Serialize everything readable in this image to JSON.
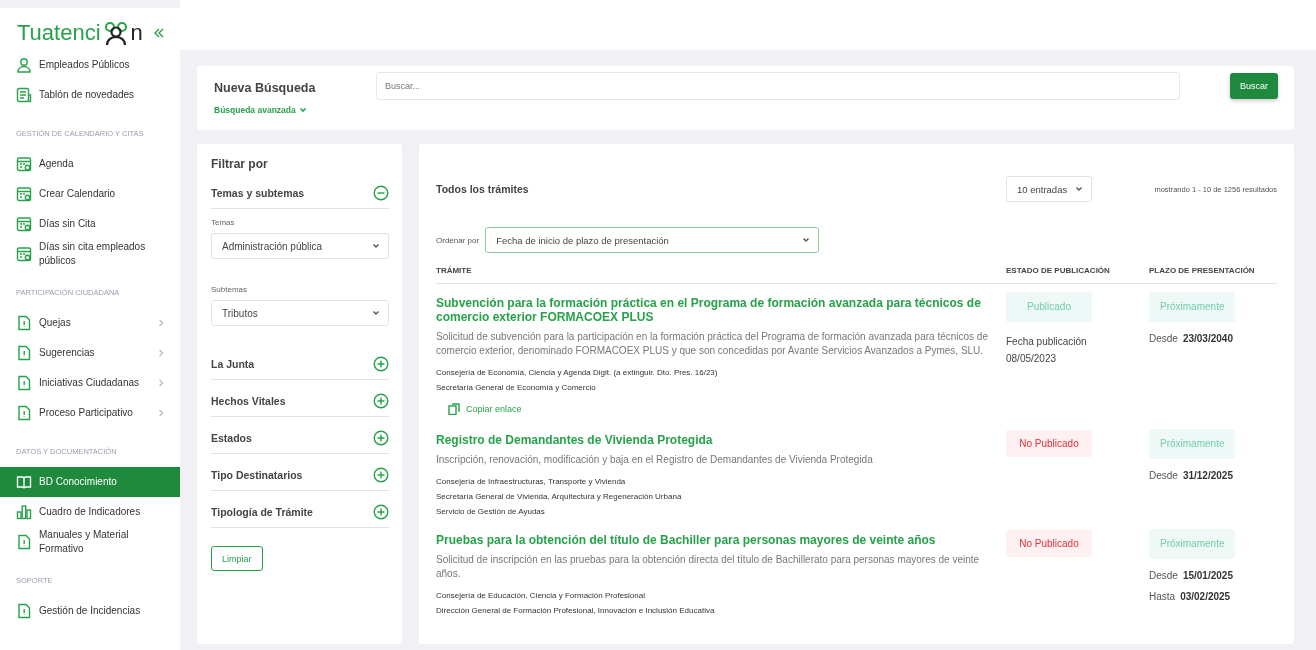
{
  "logo": {
    "text_start": "Tuatenci",
    "text_end": "n"
  },
  "sidebar": {
    "items": [
      {
        "kind": "item",
        "label": "Empleados Públicos",
        "selected": false,
        "has_submenu": false
      },
      {
        "kind": "item",
        "label": "Tablón de novedades",
        "selected": false,
        "has_submenu": false
      },
      {
        "kind": "header",
        "label": "GESTIÓN DE CALENDARIO Y CITAS"
      },
      {
        "kind": "item",
        "label": "Agenda",
        "selected": false,
        "has_submenu": false
      },
      {
        "kind": "item",
        "label": "Crear Calendario",
        "selected": false,
        "has_submenu": false
      },
      {
        "kind": "item",
        "label": "Días sin Cita",
        "selected": false,
        "has_submenu": false
      },
      {
        "kind": "item",
        "label": "Días sin cita empleados públicos",
        "selected": false,
        "has_submenu": false
      },
      {
        "kind": "header",
        "label": "PARTICIPACIÓN CIUDADANA"
      },
      {
        "kind": "item",
        "label": "Quejas",
        "selected": false,
        "has_submenu": true
      },
      {
        "kind": "item",
        "label": "Sugerencias",
        "selected": false,
        "has_submenu": true
      },
      {
        "kind": "item",
        "label": "Iniciativas Ciudadanas",
        "selected": false,
        "has_submenu": true
      },
      {
        "kind": "item",
        "label": "Proceso Participativo",
        "selected": false,
        "has_submenu": true
      },
      {
        "kind": "header",
        "label": "DATOS Y DOCUMENTACIÓN"
      },
      {
        "kind": "item",
        "label": "BD Conocimiento",
        "selected": true,
        "has_submenu": false
      },
      {
        "kind": "item",
        "label": "Cuadro de Indicadores",
        "selected": false,
        "has_submenu": false
      },
      {
        "kind": "item",
        "label": "Manuales y Material Formativo",
        "selected": false,
        "has_submenu": false
      },
      {
        "kind": "header",
        "label": "SOPORTE"
      },
      {
        "kind": "item",
        "label": "Gestión de Incidencias",
        "selected": false,
        "has_submenu": false
      }
    ]
  },
  "search": {
    "title": "Nueva Búsqueda",
    "advanced_link": "Búsqueda avanzada",
    "placeholder": "Buscar...",
    "button": "Buscar"
  },
  "filters": {
    "title": "Filtrar por",
    "groups": [
      {
        "label": "Temas y subtemas",
        "expanded": true,
        "selects": [
          {
            "label": "Temas",
            "value": "Administración pública"
          },
          {
            "label": "Subtemas",
            "value": "Tributos"
          }
        ]
      },
      {
        "label": "La Junta",
        "expanded": false
      },
      {
        "label": "Hechos Vitales",
        "expanded": false
      },
      {
        "label": "Estados",
        "expanded": false
      },
      {
        "label": "Tipo Destinatarios",
        "expanded": false
      },
      {
        "label": "Tipología de Trámite",
        "expanded": false
      }
    ],
    "clear_button": "Limpiar"
  },
  "results": {
    "title": "Todos los trámites",
    "page_size": "10 entradas",
    "count": "mostrando 1 - 10 de 1256 resultados",
    "sort_label": "Ordenar por",
    "sort_value": "Fecha de inicio de plazo de presentación",
    "columns": [
      "TRÁMITE",
      "ESTADO DE PUBLICACIÓN",
      "PLAZO DE PRESENTACIÓN"
    ],
    "rows": [
      {
        "title": "Subvención para la formación práctica en el Programa de formación avanzada para técnicos de comercio exterior FORMACOEX PLUS",
        "description": "Solicitud de subvención para la participación en la formación práctica del Programa de formación avanzada para técnicos de comercio exterior, denominado FORMACOEX PLUS y que son concedidas por Avante Servicios Avanzados a Pymes, SLU.",
        "organisms": [
          "Consejería de Economía, Ciencia y Agenda Digit. (a extinguir. Dto. Pres. 16/23)",
          "Secretaría General de Economía y Comercio"
        ],
        "copy_link": "Copiar enlace",
        "status": {
          "kind": "published",
          "label": "Publicado"
        },
        "publication": {
          "label": "Fecha publicación",
          "date": "08/05/2023"
        },
        "deadline_status": "Próximamente",
        "dates": [
          {
            "label": "Desde",
            "value": "23/03/2040"
          }
        ]
      },
      {
        "title": "Registro de Demandantes de Vivienda Protegida",
        "description": "Inscripción, renovación, modificación y baja en el Registro de Demandantes de Vivienda Protegida",
        "organisms": [
          "Consejería de Infraestructuras, Transporte y Vivienda",
          "Secretaría General de Vivienda, Arquitectura y Regeneración Urbana",
          "Servicio de Gestión de Ayudas"
        ],
        "status": {
          "kind": "unpublished",
          "label": "No Publicado"
        },
        "deadline_status": "Próximamente",
        "dates": [
          {
            "label": "Desde",
            "value": "31/12/2025"
          }
        ]
      },
      {
        "title": "Pruebas para la obtención del título de Bachiller para personas mayores de veinte años",
        "description": "Solicitud de inscripción en las pruebas para la obtención directa del título de Bachillerato para personas mayores de veinte años.",
        "organisms": [
          "Consejería de Educación, Ciencia y Formación Profesional",
          "Dirección General de Formación Profesional, Innovación e Inclusión Educativa"
        ],
        "status": {
          "kind": "unpublished",
          "label": "No Publicado"
        },
        "deadline_status": "Próximamente",
        "dates": [
          {
            "label": "Desde",
            "value": "15/01/2025"
          },
          {
            "label": "Hasta",
            "value": "03/02/2025"
          }
        ]
      }
    ]
  }
}
